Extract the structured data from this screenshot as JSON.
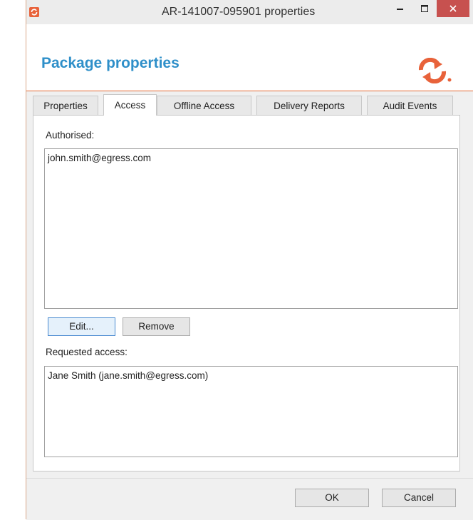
{
  "window": {
    "title": "AR-141007-095901 properties"
  },
  "header": {
    "title": "Package properties"
  },
  "tabs": [
    {
      "label": "Properties"
    },
    {
      "label": "Access"
    },
    {
      "label": "Offline Access"
    },
    {
      "label": "Delivery Reports"
    },
    {
      "label": "Audit Events"
    }
  ],
  "access": {
    "authorised_label": "Authorised:",
    "authorised_items": [
      "john.smith@egress.com"
    ],
    "edit_label": "Edit...",
    "remove_label": "Remove",
    "requested_label": "Requested access:",
    "requested_items": [
      "Jane Smith (jane.smith@egress.com)"
    ]
  },
  "footer": {
    "ok_label": "OK",
    "cancel_label": "Cancel"
  },
  "colors": {
    "brand_orange": "#e8623a",
    "title_blue": "#2e8fc9",
    "close_red": "#c7514f"
  },
  "icons": {
    "app": "egress-sync-icon",
    "logo": "egress-logo-icon",
    "minimize": "minimize-icon",
    "maximize": "maximize-icon",
    "close": "close-icon"
  }
}
